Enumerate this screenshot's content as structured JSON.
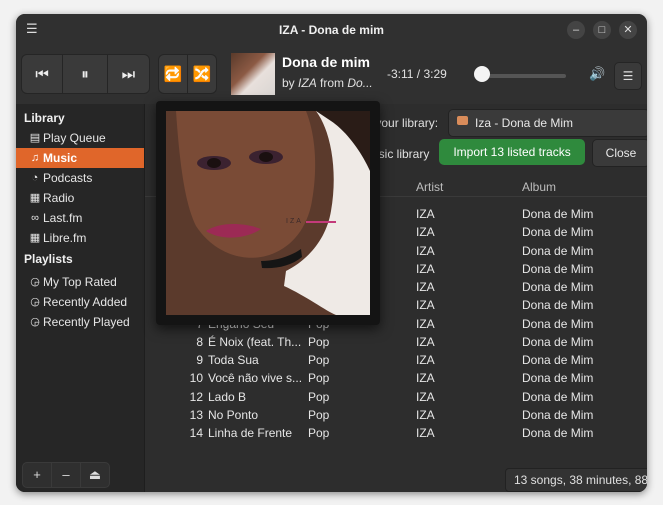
{
  "window": {
    "title": "IZA - Dona de mim",
    "menu_icon": "hamburger-icon"
  },
  "now_playing": {
    "title": "Dona de mim",
    "by_prefix": "by",
    "artist": "IZA",
    "from_word": "from",
    "album_truncated": "Do...",
    "time": "-3:11 / 3:29",
    "progress": 0.12
  },
  "sidebar": {
    "library_heading": "Library",
    "library_items": [
      {
        "label": "Play Queue",
        "icon": "queue-icon"
      },
      {
        "label": "Music",
        "icon": "music-note-icon",
        "active": true
      },
      {
        "label": "Podcasts",
        "icon": "rss-icon"
      },
      {
        "label": "Radio",
        "icon": "radio-icon"
      },
      {
        "label": "Last.fm",
        "icon": "lastfm-icon"
      },
      {
        "label": "Libre.fm",
        "icon": "librefm-icon"
      }
    ],
    "playlists_heading": "Playlists",
    "playlist_items": [
      {
        "label": "My Top Rated"
      },
      {
        "label": "Recently Added"
      },
      {
        "label": "Recently Played"
      }
    ],
    "buttons": {
      "add": "+",
      "remove": "–",
      "eject": "⏏"
    }
  },
  "banner": {
    "text1": "d to your library:",
    "library_select": "Iza - Dona de Mim",
    "text2": "e music library",
    "import_label": "Import 13 listed tracks",
    "close_label": "Close"
  },
  "table": {
    "headers": {
      "artist": "Artist",
      "album": "Album"
    },
    "rows": [
      {
        "num": "",
        "title": "",
        "genre": "",
        "artist": "IZA",
        "album": "Dona de Mim"
      },
      {
        "num": "",
        "title": "",
        "genre": "",
        "artist": "IZA",
        "album": "Dona de Mim"
      },
      {
        "num": "",
        "title": "",
        "genre": "",
        "artist": "IZA",
        "album": "Dona de Mim"
      },
      {
        "num": "",
        "title": "",
        "genre": "",
        "artist": "IZA",
        "album": "Dona de Mim"
      },
      {
        "num": "",
        "title": "",
        "genre": "",
        "artist": "IZA",
        "album": "Dona de Mim"
      },
      {
        "num": "",
        "title": "",
        "genre": "",
        "artist": "IZA",
        "album": "Dona de Mim"
      },
      {
        "num": "7",
        "title": "Engano Seu",
        "genre": "Pop",
        "artist": "IZA",
        "album": "Dona de Mim"
      },
      {
        "num": "8",
        "title": "É Noix (feat. Th...",
        "genre": "Pop",
        "artist": "IZA",
        "album": "Dona de Mim"
      },
      {
        "num": "9",
        "title": "Toda Sua",
        "genre": "Pop",
        "artist": "IZA",
        "album": "Dona de Mim"
      },
      {
        "num": "10",
        "title": "Você não vive s...",
        "genre": "Pop",
        "artist": "IZA",
        "album": "Dona de Mim"
      },
      {
        "num": "12",
        "title": "Lado B",
        "genre": "Pop",
        "artist": "IZA",
        "album": "Dona de Mim"
      },
      {
        "num": "13",
        "title": "No Ponto",
        "genre": "Pop",
        "artist": "IZA",
        "album": "Dona de Mim"
      },
      {
        "num": "14",
        "title": "Linha de Frente",
        "genre": "Pop",
        "artist": "IZA",
        "album": "Dona de Mim"
      }
    ]
  },
  "status": "13 songs, 38 minutes, 88",
  "cover": {
    "text": "IZA",
    "accent": "#c33a7a"
  },
  "colors": {
    "accent": "#e0662a",
    "import": "#2f8a3d"
  }
}
